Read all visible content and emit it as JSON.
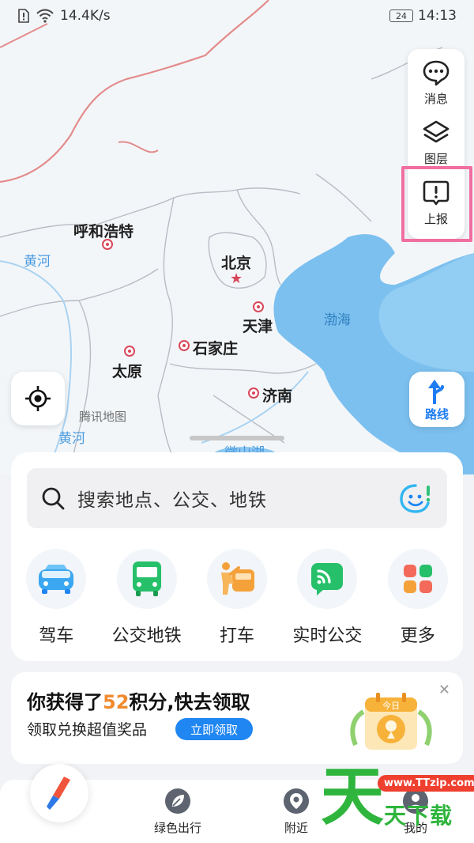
{
  "status_bar": {
    "speed": "14.4K/s",
    "battery": "24",
    "time": "14:13"
  },
  "map": {
    "cities": {
      "huhehaote": "呼和浩特",
      "beijing": "北京",
      "tianjin": "天津",
      "shijiazhuang": "石家庄",
      "taiyuan": "太原",
      "jinan": "济南"
    },
    "rivers": {
      "yellow_river_1": "黄河",
      "yellow_river_2": "黄河",
      "weishan_lake": "微山湖"
    },
    "sea": "渤海",
    "watermark": "腾讯地图"
  },
  "tool_panel": {
    "messages": "消息",
    "layers": "图层",
    "report": "上报"
  },
  "route_label": "路线",
  "search": {
    "placeholder": "搜索地点、公交、地铁"
  },
  "quick_actions": [
    {
      "label": "驾车",
      "icon": "car-icon"
    },
    {
      "label": "公交地铁",
      "icon": "bus-icon"
    },
    {
      "label": "打车",
      "icon": "taxi-icon"
    },
    {
      "label": "实时公交",
      "icon": "realtime-bus-icon"
    },
    {
      "label": "更多",
      "icon": "more-grid-icon"
    }
  ],
  "promo": {
    "title_pre": "你获得了",
    "points": "52",
    "title_post": "积分,快去领取",
    "subtitle": "领取兑换超值奖品",
    "button": "立即领取",
    "badge": "今日"
  },
  "bottom_nav": {
    "green_travel": "绿色出行",
    "nearby": "附近",
    "mine": "我的"
  },
  "brand_watermark": {
    "big": "天",
    "url": "www.TTzip.com",
    "small": "天下载"
  },
  "colors": {
    "accent": "#1f86f2",
    "points": "#f08a2e",
    "highlight": "#f06ea0"
  }
}
